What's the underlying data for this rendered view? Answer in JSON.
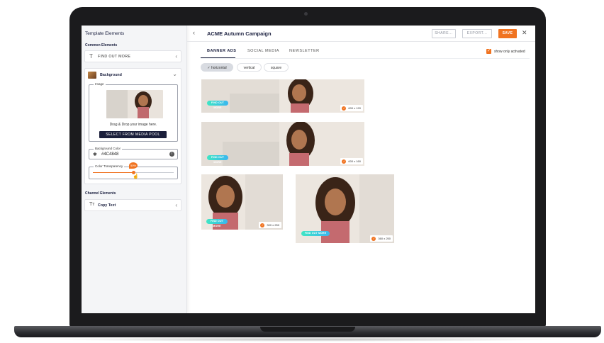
{
  "sidebar": {
    "title": "Template Elements",
    "common_heading": "Common Elements",
    "find_out_more": "FIND OUT MORE",
    "background": {
      "label": "Background",
      "image_legend": "Image",
      "drag_drop": "Drag & Drop your image here.",
      "media_button": "SELECT FROM MEDIA POOL",
      "color_legend": "Background Color",
      "color_value": "#4C4848",
      "transparency_legend": "Color Transparency",
      "transparency_value": "50%",
      "transparency_level": 0.5
    },
    "channel_heading": "Channel Elements",
    "copy_text": "Copy Text"
  },
  "header": {
    "title": "ACME Autumn Campaign",
    "share": "SHARE...",
    "export": "EXPORT...",
    "save": "SAVE"
  },
  "tabs": [
    {
      "label": "BANNER ADS",
      "active": true
    },
    {
      "label": "SOCIAL MEDIA",
      "active": false
    },
    {
      "label": "NEWSLETTER",
      "active": false
    }
  ],
  "show_only_activated": {
    "label": "show only activated",
    "checked": true
  },
  "chips": [
    {
      "label": "horizontal",
      "active": true
    },
    {
      "label": "vertical",
      "active": false
    },
    {
      "label": "square",
      "active": false
    }
  ],
  "banners": [
    {
      "cta": "FIND OUT MORE",
      "size": "600 x 120"
    },
    {
      "cta": "FIND OUT MORE",
      "size": "600 x 160"
    },
    {
      "cta": "FIND OUT MORE",
      "size": "300 x 250"
    },
    {
      "cta": "FIND OUT MORE",
      "size": "360 x 250"
    }
  ],
  "colors": {
    "accent": "#f07320",
    "navy": "#1b1f3b",
    "cta_start": "#3fe6c4",
    "cta_end": "#3ab6f0"
  },
  "icons": [
    "text-icon",
    "chevron-left-icon",
    "chevron-down-icon",
    "palette-icon",
    "info-icon",
    "back-arrow-icon",
    "close-icon",
    "check-icon",
    "text-format-icon"
  ]
}
